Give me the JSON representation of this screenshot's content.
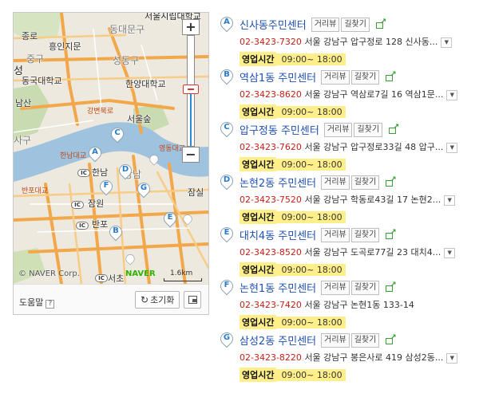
{
  "map": {
    "labels": {
      "seoul_univ_hospital": "서울시립대학교",
      "jongno": "종로",
      "dongdaemun": "동대문구",
      "heungin": "흥인지문",
      "junggu": "중구",
      "seongdong": "성동구",
      "seong": "성",
      "dongguk": "동국대학교",
      "hanyang": "한양대학교",
      "namsan": "남산",
      "seoul_forest": "서울숲",
      "yongsan": "용산",
      "sa": "사구",
      "gangnam": "강남",
      "sa2": "사구",
      "hannam_bridge": "한남대교",
      "banpo_bridge": "반포대교",
      "yeongdong_bridge": "영동대교",
      "jamsil": "잠실",
      "hannam": "한남",
      "jamwon": "잠원",
      "banpo": "반포",
      "seocho": "서초",
      "gangbyeon": "강변북로"
    },
    "ic_badges": [
      "IC",
      "IC",
      "IC",
      "IC"
    ],
    "markers": [
      "A",
      "B",
      "C",
      "D",
      "E",
      "F",
      "G"
    ],
    "zoom_in": "+",
    "zoom_out": "−",
    "copyright": "© NAVER Corp.",
    "naver_logo": "NAVER",
    "scale_text": "1.6km",
    "help_label": "도움말",
    "help_q": "?",
    "reset_label": "초기화"
  },
  "buttons": {
    "view": "거리뷰",
    "route": "길찾기",
    "more": "▼"
  },
  "hours_label": "영업시간",
  "results": [
    {
      "letter": "A",
      "name": "신사동주민센터",
      "phone": "02-3423-7320",
      "addr": "서울 강남구 압구정로 128 신사동...",
      "hours": "09:00~ 18:00",
      "has_more": true
    },
    {
      "letter": "B",
      "name": "역삼1동 주민센터",
      "phone": "02-3423-8620",
      "addr": "서울 강남구 역삼로7길 16 역삼1문...",
      "hours": "09:00~ 18:00",
      "has_more": true
    },
    {
      "letter": "C",
      "name": "압구정동 주민센터",
      "phone": "02-3423-7620",
      "addr": "서울 강남구 압구정로33길 48 압구...",
      "hours": "09:00~ 18:00",
      "has_more": true
    },
    {
      "letter": "D",
      "name": "논현2동 주민센터",
      "phone": "02-3423-7520",
      "addr": "서울 강남구 학동로43길 17 논현2...",
      "hours": "09:00~ 18:00",
      "has_more": true
    },
    {
      "letter": "E",
      "name": "대치4동 주민센터",
      "phone": "02-3423-8520",
      "addr": "서울 강남구 도곡로77길 23 대치4...",
      "hours": "09:00~ 18:00",
      "has_more": true
    },
    {
      "letter": "F",
      "name": "논현1동 주민센터",
      "phone": "02-3423-7420",
      "addr": "서울 강남구 논현1동 133-14",
      "hours": "09:00~ 18:00",
      "has_more": false
    },
    {
      "letter": "G",
      "name": "삼성2동 주민센터",
      "phone": "02-3423-8220",
      "addr": "서울 강남구 봉은사로 419 삼성2동...",
      "hours": "09:00~ 18:00",
      "has_more": true
    }
  ],
  "colors": {
    "name_link": "#1e50b4",
    "phone": "#c4221a",
    "hours_bg": "#ffef8a",
    "marker_letter": "#2a7cc7",
    "share_green": "#3aa035",
    "naver_green": "#2db400"
  }
}
